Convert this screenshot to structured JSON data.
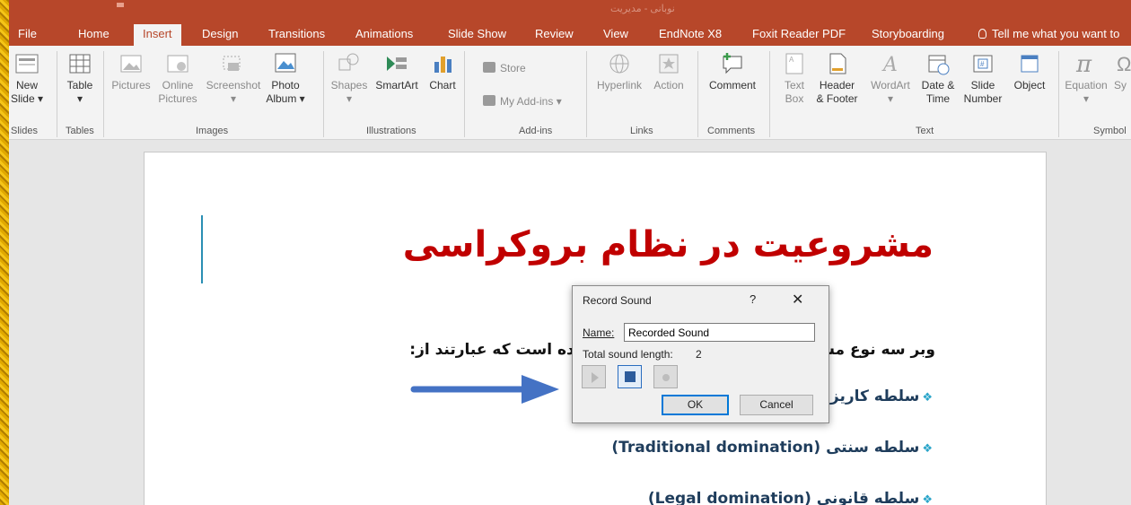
{
  "window": {
    "doc_title": "نوبانی - مدیریت",
    "tabs": [
      "File",
      "Home",
      "Insert",
      "Design",
      "Transitions",
      "Animations",
      "Slide Show",
      "Review",
      "View",
      "EndNote X8",
      "Foxit Reader PDF",
      "Storyboarding"
    ],
    "active_tab": "Insert",
    "tell_me": "Tell me what you want to"
  },
  "ribbon": {
    "slides": {
      "new_slide": "New",
      "new_slide_2": "Slide",
      "group": "Slides"
    },
    "tables": {
      "table": "Table",
      "group": "Tables"
    },
    "images": {
      "pictures": "Pictures",
      "online": "Online",
      "online_2": "Pictures",
      "screenshot": "Screenshot",
      "photo": "Photo",
      "photo_2": "Album",
      "group": "Images"
    },
    "illustrations": {
      "shapes": "Shapes",
      "smartart": "SmartArt",
      "chart": "Chart",
      "group": "Illustrations"
    },
    "addins": {
      "store": "Store",
      "myaddins": "My Add-ins",
      "group": "Add-ins"
    },
    "links": {
      "hyperlink": "Hyperlink",
      "action": "Action",
      "group": "Links"
    },
    "comments": {
      "comment": "Comment",
      "group": "Comments"
    },
    "text": {
      "textbox": "Text",
      "textbox_2": "Box",
      "header": "Header",
      "header_2": "& Footer",
      "wordart": "WordArt",
      "date": "Date &",
      "date_2": "Time",
      "slidenum": "Slide",
      "slidenum_2": "Number",
      "object": "Object",
      "group": "Text"
    },
    "symbols": {
      "equation": "Equation",
      "sym": "Sy",
      "group": "Symbol"
    }
  },
  "slide": {
    "title": "مشروعیت در نظام بروکراسی",
    "line1_right": "وبر سه نوع مشر",
    "line1_left": "ی داده است که عبارتند از:",
    "bullet1": "سلطه کاریزما",
    "bullet2": "سلطه سنتی (Traditional domination)",
    "bullet3": "سلطه قانونی (Legal domination)"
  },
  "dialog": {
    "title": "Record Sound",
    "help": "?",
    "close": "✕",
    "name_label": "Name:",
    "name_value": "Recorded Sound",
    "length_label": "Total sound length:",
    "length_value": "2",
    "ok": "OK",
    "cancel": "Cancel"
  },
  "colors": {
    "ribbon_accent": "#b7472a",
    "title_red": "#c00000",
    "arrow_blue": "#4472c4"
  }
}
